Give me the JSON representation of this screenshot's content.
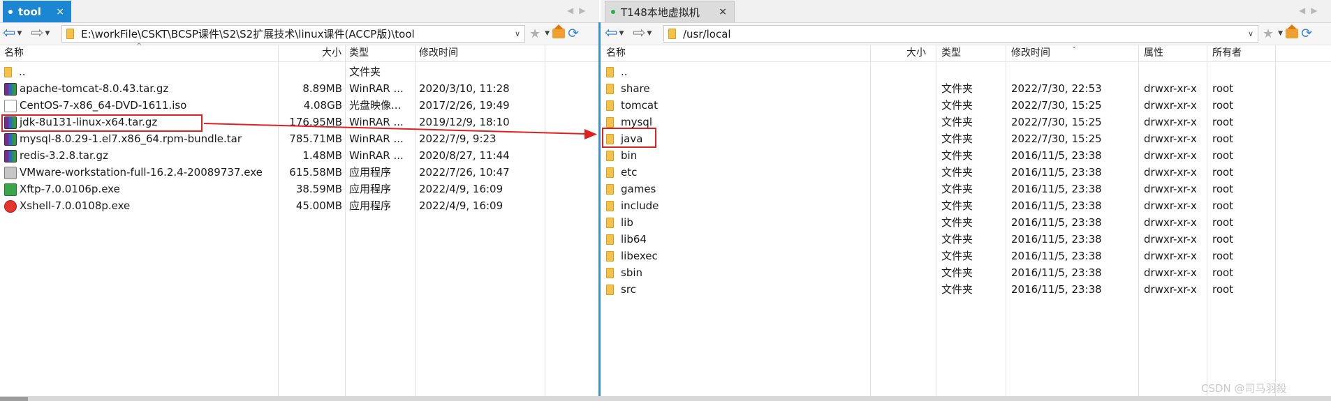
{
  "left": {
    "tab_label": "tool",
    "tab_close": "×",
    "path": "E:\\workFile\\CSKT\\BCSP课件\\S2\\S2扩展技术\\linux课件(ACCP版)\\tool",
    "headers": {
      "name": "名称",
      "size": "大小",
      "type": "类型",
      "modified": "修改时间"
    },
    "files": [
      {
        "name": "..",
        "size": "",
        "type": "文件夹",
        "modified": "",
        "icon": "folder-icon"
      },
      {
        "name": "apache-tomcat-8.0.43.tar.gz",
        "size": "8.89MB",
        "type": "WinRAR ...",
        "modified": "2020/3/10, 11:28",
        "icon": "winrar-icon"
      },
      {
        "name": "CentOS-7-x86_64-DVD-1611.iso",
        "size": "4.08GB",
        "type": "光盘映像...",
        "modified": "2017/2/26, 19:49",
        "icon": "iso-icon"
      },
      {
        "name": "jdk-8u131-linux-x64.tar.gz",
        "size": "176.95MB",
        "type": "WinRAR ...",
        "modified": "2019/12/9, 18:10",
        "icon": "winrar-icon"
      },
      {
        "name": "mysql-8.0.29-1.el7.x86_64.rpm-bundle.tar",
        "size": "785.71MB",
        "type": "WinRAR ...",
        "modified": "2022/7/9, 9:23",
        "icon": "winrar-icon"
      },
      {
        "name": "redis-3.2.8.tar.gz",
        "size": "1.48MB",
        "type": "WinRAR ...",
        "modified": "2020/8/27, 11:44",
        "icon": "winrar-icon"
      },
      {
        "name": "VMware-workstation-full-16.2.4-20089737.exe",
        "size": "615.58MB",
        "type": "应用程序",
        "modified": "2022/7/26, 10:47",
        "icon": "vmware-icon"
      },
      {
        "name": "Xftp-7.0.0106p.exe",
        "size": "38.59MB",
        "type": "应用程序",
        "modified": "2022/4/9, 16:09",
        "icon": "xftp-icon"
      },
      {
        "name": "Xshell-7.0.0108p.exe",
        "size": "45.00MB",
        "type": "应用程序",
        "modified": "2022/4/9, 16:09",
        "icon": "xshell-icon"
      }
    ]
  },
  "right": {
    "tab_label": "T148本地虚拟机",
    "tab_close": "×",
    "path": "/usr/local",
    "headers": {
      "name": "名称",
      "size": "大小",
      "type": "类型",
      "modified": "修改时间",
      "attr": "属性",
      "owner": "所有者"
    },
    "files": [
      {
        "name": "..",
        "type": "",
        "modified": "",
        "attr": "",
        "owner": ""
      },
      {
        "name": "share",
        "type": "文件夹",
        "modified": "2022/7/30, 22:53",
        "attr": "drwxr-xr-x",
        "owner": "root"
      },
      {
        "name": "tomcat",
        "type": "文件夹",
        "modified": "2022/7/30, 15:25",
        "attr": "drwxr-xr-x",
        "owner": "root"
      },
      {
        "name": "mysql",
        "type": "文件夹",
        "modified": "2022/7/30, 15:25",
        "attr": "drwxr-xr-x",
        "owner": "root"
      },
      {
        "name": "java",
        "type": "文件夹",
        "modified": "2022/7/30, 15:25",
        "attr": "drwxr-xr-x",
        "owner": "root"
      },
      {
        "name": "bin",
        "type": "文件夹",
        "modified": "2016/11/5, 23:38",
        "attr": "drwxr-xr-x",
        "owner": "root"
      },
      {
        "name": "etc",
        "type": "文件夹",
        "modified": "2016/11/5, 23:38",
        "attr": "drwxr-xr-x",
        "owner": "root"
      },
      {
        "name": "games",
        "type": "文件夹",
        "modified": "2016/11/5, 23:38",
        "attr": "drwxr-xr-x",
        "owner": "root"
      },
      {
        "name": "include",
        "type": "文件夹",
        "modified": "2016/11/5, 23:38",
        "attr": "drwxr-xr-x",
        "owner": "root"
      },
      {
        "name": "lib",
        "type": "文件夹",
        "modified": "2016/11/5, 23:38",
        "attr": "drwxr-xr-x",
        "owner": "root"
      },
      {
        "name": "lib64",
        "type": "文件夹",
        "modified": "2016/11/5, 23:38",
        "attr": "drwxr-xr-x",
        "owner": "root"
      },
      {
        "name": "libexec",
        "type": "文件夹",
        "modified": "2016/11/5, 23:38",
        "attr": "drwxr-xr-x",
        "owner": "root"
      },
      {
        "name": "sbin",
        "type": "文件夹",
        "modified": "2016/11/5, 23:38",
        "attr": "drwxr-xr-x",
        "owner": "root"
      },
      {
        "name": "src",
        "type": "文件夹",
        "modified": "2016/11/5, 23:38",
        "attr": "drwxr-xr-x",
        "owner": "root"
      }
    ]
  },
  "watermark": "CSDN @司马羽殺",
  "colors": {
    "accent": "#1b86d2",
    "highlight": "#e02020",
    "folder": "#f4c24a"
  }
}
